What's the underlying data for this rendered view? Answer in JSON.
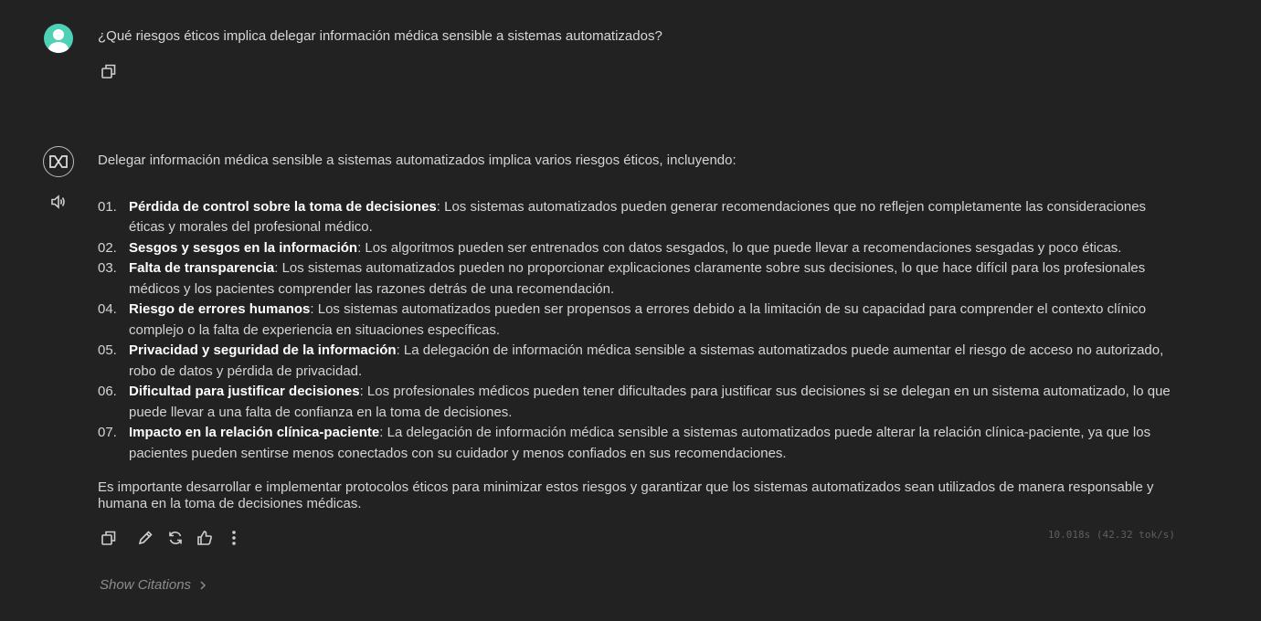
{
  "user_message": {
    "text": "¿Qué riesgos éticos implica delegar información médica sensible a sistemas automatizados?"
  },
  "assistant": {
    "intro": "Delegar información médica sensible a sistemas automatizados implica varios riesgos éticos, incluyendo:",
    "items": [
      {
        "num": "01.",
        "title": "Pérdida de control sobre la toma de decisiones",
        "text": ": Los sistemas automatizados pueden generar recomendaciones que no reflejen completamente las consideraciones éticas y morales del profesional médico."
      },
      {
        "num": "02.",
        "title": "Sesgos y sesgos en la información",
        "text": ": Los algoritmos pueden ser entrenados con datos sesgados, lo que puede llevar a recomendaciones sesgadas y poco éticas."
      },
      {
        "num": "03.",
        "title": "Falta de transparencia",
        "text": ": Los sistemas automatizados pueden no proporcionar explicaciones claramente sobre sus decisiones, lo que hace difícil para los profesionales médicos y los pacientes comprender las razones detrás de una recomendación."
      },
      {
        "num": "04.",
        "title": "Riesgo de errores humanos",
        "text": ": Los sistemas automatizados pueden ser propensos a errores debido a la limitación de su capacidad para comprender el contexto clínico complejo o la falta de experiencia en situaciones específicas."
      },
      {
        "num": "05.",
        "title": "Privacidad y seguridad de la información",
        "text": ": La delegación de información médica sensible a sistemas automatizados puede aumentar el riesgo de acceso no autorizado, robo de datos y pérdida de privacidad."
      },
      {
        "num": "06.",
        "title": "Dificultad para justificar decisiones",
        "text": ": Los profesionales médicos pueden tener dificultades para justificar sus decisiones si se delegan en un sistema automatizado, lo que puede llevar a una falta de confianza en la toma de decisiones."
      },
      {
        "num": "07.",
        "title": "Impacto en la relación clínica-paciente",
        "text": ": La delegación de información médica sensible a sistemas automatizados puede alterar la relación clínica-paciente, ya que los pacientes pueden sentirse menos conectados con su cuidador y menos confiados en sus recomendaciones."
      }
    ],
    "conclusion": "Es importante desarrollar e implementar protocolos éticos para minimizar estos riesgos y garantizar que los sistemas automatizados sean utilizados de manera responsable y humana en la toma de decisiones médicas.",
    "metrics": "10.018s (42.32 tok/s)",
    "show_citations": "Show Citations"
  },
  "icons": {
    "user_copy": "copy-icon",
    "speaker": "speaker-icon",
    "copy": "copy-icon",
    "edit": "pencil-icon",
    "regenerate": "refresh-icon",
    "like": "thumbs-up-icon",
    "more": "more-vertical-icon",
    "citations_chevron": "chevron-right-icon"
  },
  "colors": {
    "background": "#222222",
    "user_avatar": "#4fd1b5"
  }
}
